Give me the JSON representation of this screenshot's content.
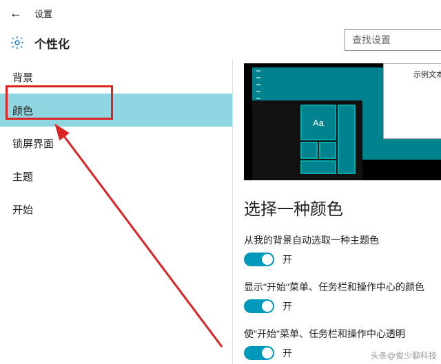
{
  "topbar": {
    "title": "设置"
  },
  "header": {
    "page_title": "个性化"
  },
  "search": {
    "placeholder": "查找设置"
  },
  "sidebar": {
    "items": [
      {
        "label": "背景"
      },
      {
        "label": "颜色"
      },
      {
        "label": "锁屏界面"
      },
      {
        "label": "主题"
      },
      {
        "label": "开始"
      }
    ]
  },
  "preview": {
    "sample_text": "示例文本",
    "tile_caption": "Aa"
  },
  "content": {
    "section_title": "选择一种颜色",
    "settings": [
      {
        "label": "从我的背景自动选取一种主题色",
        "value": "开"
      },
      {
        "label": "显示\"开始\"菜单、任务栏和操作中心的颜色",
        "value": "开"
      },
      {
        "label": "使\"开始\"菜单、任务栏和操作中心透明",
        "value": "开"
      }
    ]
  },
  "watermark": "头条@俊少聊科技"
}
